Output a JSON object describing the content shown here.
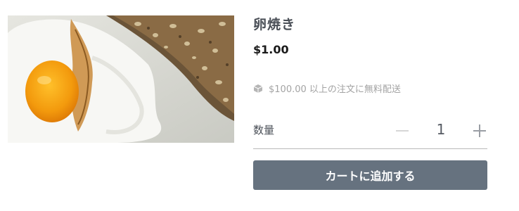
{
  "product": {
    "image_alt": "目玉焼きとパン",
    "title": "卵焼き",
    "price": "$1.00",
    "shipping_icon": "box-icon",
    "shipping_text": "$100.00 以上の注文に無料配送"
  },
  "quantity": {
    "label": "数量",
    "value": "1",
    "minus_icon": "minus-icon",
    "plus_icon": "plus-icon"
  },
  "actions": {
    "add_to_cart_label": "カートに追加する"
  },
  "colors": {
    "button_bg": "#66727f",
    "title": "#4a4f57",
    "muted": "#a3a3a3"
  }
}
